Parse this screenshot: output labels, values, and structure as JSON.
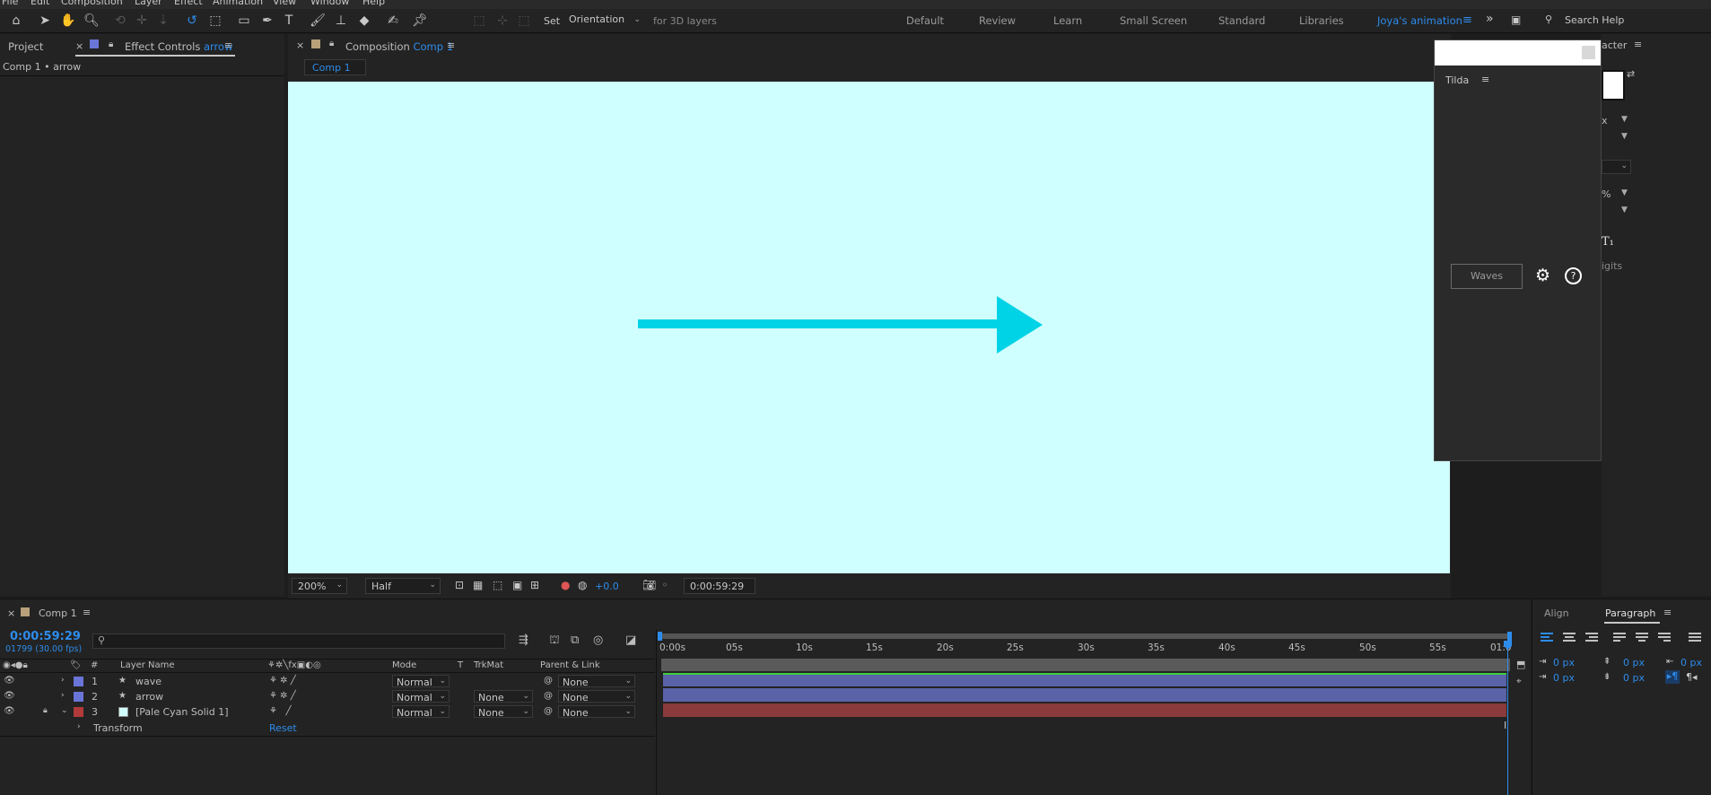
{
  "menu": [
    "File",
    "Edit",
    "Composition",
    "Layer",
    "Effect",
    "Animation",
    "View",
    "Window",
    "Help"
  ],
  "toolbar": {
    "set_label": "Set",
    "orientation": "Orientation",
    "for3d": "for 3D layers",
    "workspaces": [
      "Default",
      "Review",
      "Learn",
      "Small Screen",
      "Standard",
      "Libraries",
      "Joya's animation"
    ],
    "active_workspace": "Joya's animation",
    "search_placeholder": "Search Help"
  },
  "left_panel": {
    "tab_project": "Project",
    "tab_effect_controls": "Effect Controls",
    "effect_target": "arrow",
    "breadcrumb": "Comp 1 • arrow"
  },
  "composition": {
    "tab_label": "Composition",
    "comp_name": "Comp 1",
    "sub_tab": "Comp 1",
    "canvas_color": "#d0ffff",
    "arrow_color": "#00d3e6",
    "zoom": "200%",
    "resolution": "Half",
    "exposure": "+0.0",
    "timecode": "0:00:59:29"
  },
  "tilda": {
    "title": "Tilda",
    "waves_button": "Waves",
    "settings_icon": "gear-icon",
    "help_icon": "help-icon"
  },
  "character_panel": {
    "tab_partial": "acter",
    "unit_partial": "%",
    "digits_partial": "igits",
    "px_partial": "x"
  },
  "timeline": {
    "tab": "Comp 1",
    "timecode": "0:00:59:29",
    "frame_info": "01799 (30.00 fps)",
    "headers": {
      "num": "#",
      "layer_name": "Layer Name",
      "mode": "Mode",
      "t": "T",
      "trkmat": "TrkMat",
      "parent": "Parent & Link"
    },
    "layers": [
      {
        "num": "1",
        "name": "wave",
        "mode": "Normal",
        "trkmat": "",
        "parent": "None",
        "color": "#6a75d8"
      },
      {
        "num": "2",
        "name": "arrow",
        "mode": "Normal",
        "trkmat": "None",
        "parent": "None",
        "color": "#6a75d8"
      },
      {
        "num": "3",
        "name": "[Pale Cyan Solid 1]",
        "mode": "Normal",
        "trkmat": "None",
        "parent": "None",
        "color": "#b23a3a"
      }
    ],
    "transform_label": "Transform",
    "reset_label": "Reset",
    "ruler": [
      "0:00s",
      "05s",
      "10s",
      "15s",
      "20s",
      "25s",
      "30s",
      "35s",
      "40s",
      "45s",
      "50s",
      "55s",
      "01:0"
    ]
  },
  "paragraph_panel": {
    "tab_align": "Align",
    "tab_paragraph": "Paragraph",
    "values": [
      "0 px",
      "0 px",
      "0 px",
      "0 px",
      "0 px"
    ]
  }
}
